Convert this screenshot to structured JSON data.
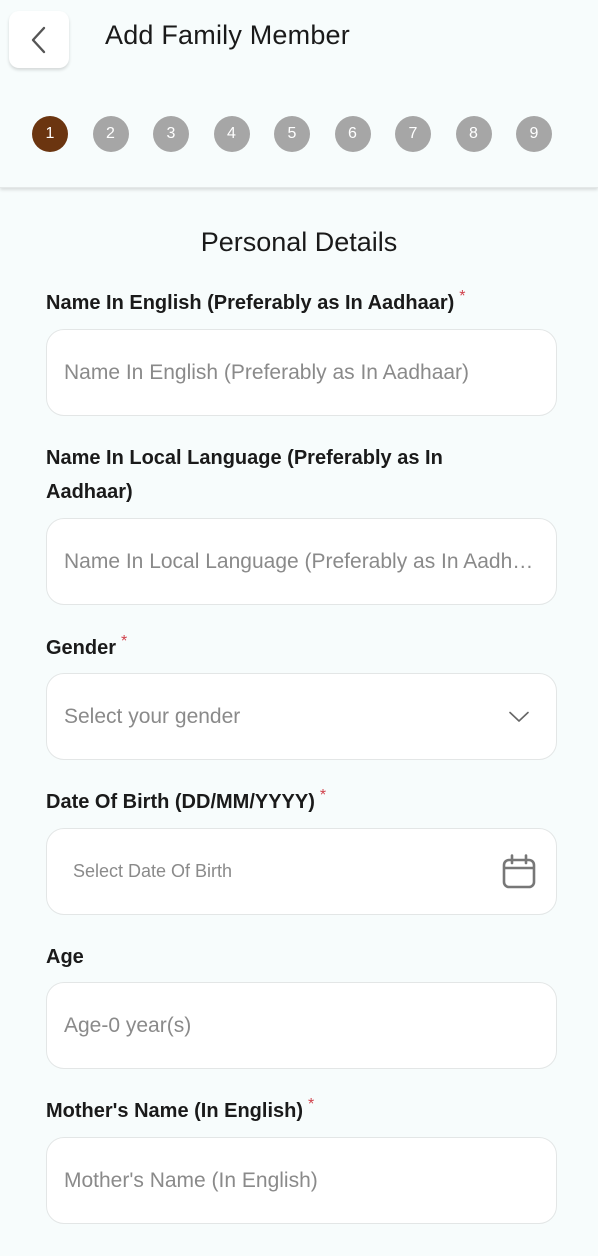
{
  "header": {
    "title": "Add Family Member",
    "back_icon": "chevron-left-icon"
  },
  "stepper": {
    "current": 1,
    "steps": [
      "1",
      "2",
      "3",
      "4",
      "5",
      "6",
      "7",
      "8",
      "9"
    ],
    "colors": {
      "active": "#6b3510",
      "inactive": "#a6a6a6"
    }
  },
  "form": {
    "section_title": "Personal Details",
    "required_mark": "*",
    "fields": [
      {
        "label": "Name In English (Preferably as In Aadhaar)",
        "required": true,
        "placeholder": "Name In English (Preferably as In Aadhaar)",
        "type": "text"
      },
      {
        "label": "Name In Local Language (Preferably as In Aadhaar)",
        "required": false,
        "placeholder": "Name In Local Language (Preferably as In Aadhaar)",
        "type": "text"
      },
      {
        "label": "Gender",
        "required": true,
        "placeholder": "Select your gender",
        "type": "select",
        "icon": "chevron-down-icon"
      },
      {
        "label": "Date Of Birth (DD/MM/YYYY)",
        "required": true,
        "placeholder": "Select Date Of Birth",
        "type": "date",
        "icon": "calendar-icon"
      },
      {
        "label": "Age",
        "required": false,
        "placeholder": "Age-0 year(s)",
        "type": "readonly"
      },
      {
        "label": "Mother's Name (In English)",
        "required": true,
        "placeholder": "Mother's Name (In English)",
        "type": "text"
      }
    ]
  }
}
